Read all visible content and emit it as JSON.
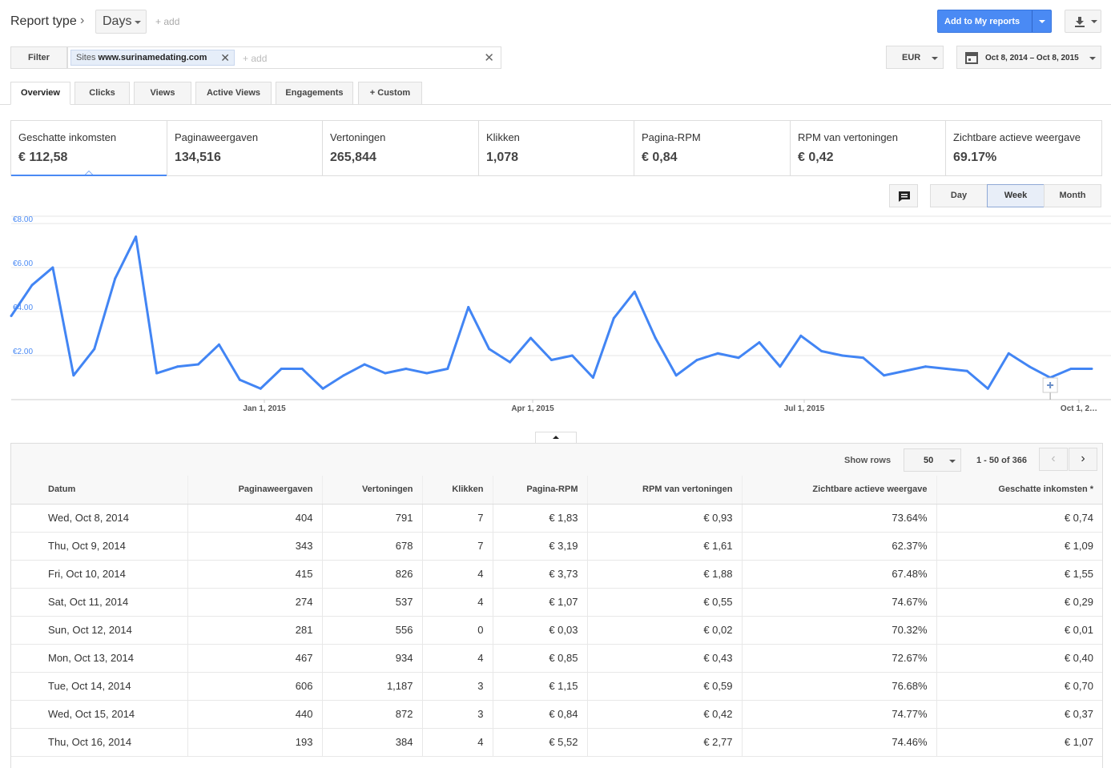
{
  "header": {
    "report_type": "Report type",
    "days": "Days",
    "add": "+ add",
    "add_to_reports": "Add to My reports"
  },
  "filter": {
    "button": "Filter",
    "chip_key": "Sites",
    "chip_value": "www.surinamedating.com",
    "add": "+ add",
    "currency": "EUR",
    "date_range": "Oct 8, 2014 – Oct 8, 2015"
  },
  "tabs": [
    "Overview",
    "Clicks",
    "Views",
    "Active Views",
    "Engagements",
    "Custom"
  ],
  "metrics": [
    {
      "label": "Geschatte inkomsten",
      "value": "€ 112,58"
    },
    {
      "label": "Paginaweergaven",
      "value": "134,516"
    },
    {
      "label": "Vertoningen",
      "value": "265,844"
    },
    {
      "label": "Klikken",
      "value": "1,078"
    },
    {
      "label": "Pagina-RPM",
      "value": "€ 0,84"
    },
    {
      "label": "RPM van vertoningen",
      "value": "€ 0,42"
    },
    {
      "label": "Zichtbare actieve weergave",
      "value": "69.17%"
    }
  ],
  "granularity": [
    "Day",
    "Week",
    "Month"
  ],
  "granularity_selected": "Week",
  "colors": {
    "accent": "#4a8af4",
    "line": "#4285f4"
  },
  "chart_data": {
    "type": "line",
    "series": [
      {
        "values": [
          3.8,
          5.2,
          6.0,
          1.1,
          2.3,
          5.5,
          7.4,
          1.2,
          1.5,
          1.6,
          2.5,
          0.9,
          0.5,
          1.4,
          1.4,
          0.5,
          1.1,
          1.6,
          1.2,
          1.4,
          1.2,
          1.4,
          4.2,
          2.3,
          1.7,
          2.8,
          1.8,
          2.0,
          1.0,
          3.7,
          4.9,
          2.8,
          1.1,
          1.8,
          2.1,
          1.9,
          2.6,
          1.5,
          2.9,
          2.2,
          2.0,
          1.9,
          1.1,
          1.3,
          1.5,
          1.4,
          1.3,
          0.5,
          2.1,
          1.5,
          1.0,
          1.4,
          1.4
        ]
      }
    ],
    "x_ticks": [
      "Jan 1, 2015",
      "Apr 1, 2015",
      "Jul 1, 2015",
      "Oct 1, 2…"
    ],
    "y_ticks": [
      "€8.00",
      "€6.00",
      "€4.00",
      "€2.00"
    ],
    "y_tick_values": [
      8,
      6,
      4,
      2
    ],
    "ylim": [
      0,
      8
    ],
    "grid": true
  },
  "table": {
    "show_rows_label": "Show rows",
    "rows": "50",
    "range": "1 - 50 of 366",
    "columns": [
      "Datum",
      "Paginaweergaven",
      "Vertoningen",
      "Klikken",
      "Pagina-RPM",
      "RPM van vertoningen",
      "Zichtbare actieve weergave",
      "Geschatte inkomsten *"
    ],
    "rows_data": [
      [
        "Wed, Oct 8, 2014",
        "404",
        "791",
        "7",
        "€ 1,83",
        "€ 0,93",
        "73.64%",
        "€ 0,74"
      ],
      [
        "Thu, Oct 9, 2014",
        "343",
        "678",
        "7",
        "€ 3,19",
        "€ 1,61",
        "62.37%",
        "€ 1,09"
      ],
      [
        "Fri, Oct 10, 2014",
        "415",
        "826",
        "4",
        "€ 3,73",
        "€ 1,88",
        "67.48%",
        "€ 1,55"
      ],
      [
        "Sat, Oct 11, 2014",
        "274",
        "537",
        "4",
        "€ 1,07",
        "€ 0,55",
        "74.67%",
        "€ 0,29"
      ],
      [
        "Sun, Oct 12, 2014",
        "281",
        "556",
        "0",
        "€ 0,03",
        "€ 0,02",
        "70.32%",
        "€ 0,01"
      ],
      [
        "Mon, Oct 13, 2014",
        "467",
        "934",
        "4",
        "€ 0,85",
        "€ 0,43",
        "72.67%",
        "€ 0,40"
      ],
      [
        "Tue, Oct 14, 2014",
        "606",
        "1,187",
        "3",
        "€ 1,15",
        "€ 0,59",
        "76.68%",
        "€ 0,70"
      ],
      [
        "Wed, Oct 15, 2014",
        "440",
        "872",
        "3",
        "€ 0,84",
        "€ 0,42",
        "74.77%",
        "€ 0,37"
      ],
      [
        "Thu, Oct 16, 2014",
        "193",
        "384",
        "4",
        "€ 5,52",
        "€ 2,77",
        "74.46%",
        "€ 1,07"
      ]
    ]
  }
}
